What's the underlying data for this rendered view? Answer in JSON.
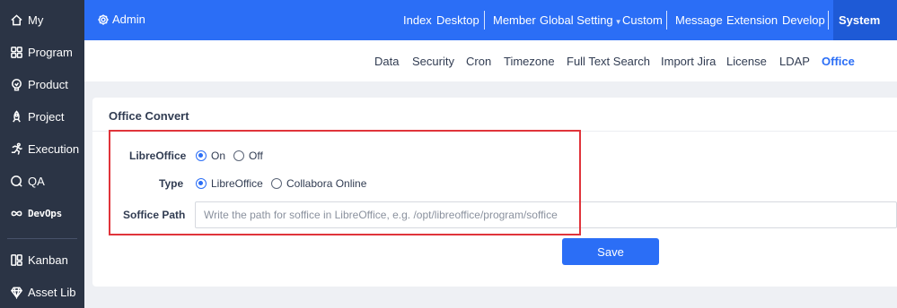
{
  "sidebar": {
    "items": [
      {
        "label": "My",
        "icon": "home-icon"
      },
      {
        "label": "Program",
        "icon": "grid-icon"
      },
      {
        "label": "Product",
        "icon": "bulb-icon"
      },
      {
        "label": "Project",
        "icon": "rocket-icon"
      },
      {
        "label": "Execution",
        "icon": "runner-icon"
      },
      {
        "label": "QA",
        "icon": "search-circle-icon"
      },
      {
        "label": "DevOps",
        "icon": "infinity-icon"
      },
      {
        "label": "Kanban",
        "icon": "kanban-icon"
      },
      {
        "label": "Asset Lib",
        "icon": "diamond-icon"
      }
    ]
  },
  "header": {
    "admin_label": "Admin",
    "nav": [
      "Index",
      "Desktop",
      "Member",
      "Global Setting",
      "Custom",
      "Message",
      "Extension",
      "Develop",
      "System"
    ],
    "active": "System"
  },
  "subnav": {
    "items": [
      "Data",
      "Security",
      "Cron",
      "Timezone",
      "Full Text Search",
      "Import Jira",
      "License",
      "LDAP",
      "Office"
    ],
    "active": "Office"
  },
  "panel": {
    "title": "Office Convert",
    "libreoffice_label": "LibreOffice",
    "libreoffice_on": "On",
    "libreoffice_off": "Off",
    "libreoffice_value": "On",
    "type_label": "Type",
    "type_option_1": "LibreOffice",
    "type_option_2": "Collabora Online",
    "type_value": "LibreOffice",
    "soffice_label": "Soffice Path",
    "soffice_value": "",
    "soffice_placeholder": "Write the path for soffice in LibreOffice, e.g. /opt/libreoffice/program/soffice",
    "save_label": "Save"
  },
  "colors": {
    "header_bg": "#2b6ef6",
    "sidebar_bg": "#2b3445",
    "highlight_border": "#e0343b",
    "primary": "#2b6ef6"
  }
}
